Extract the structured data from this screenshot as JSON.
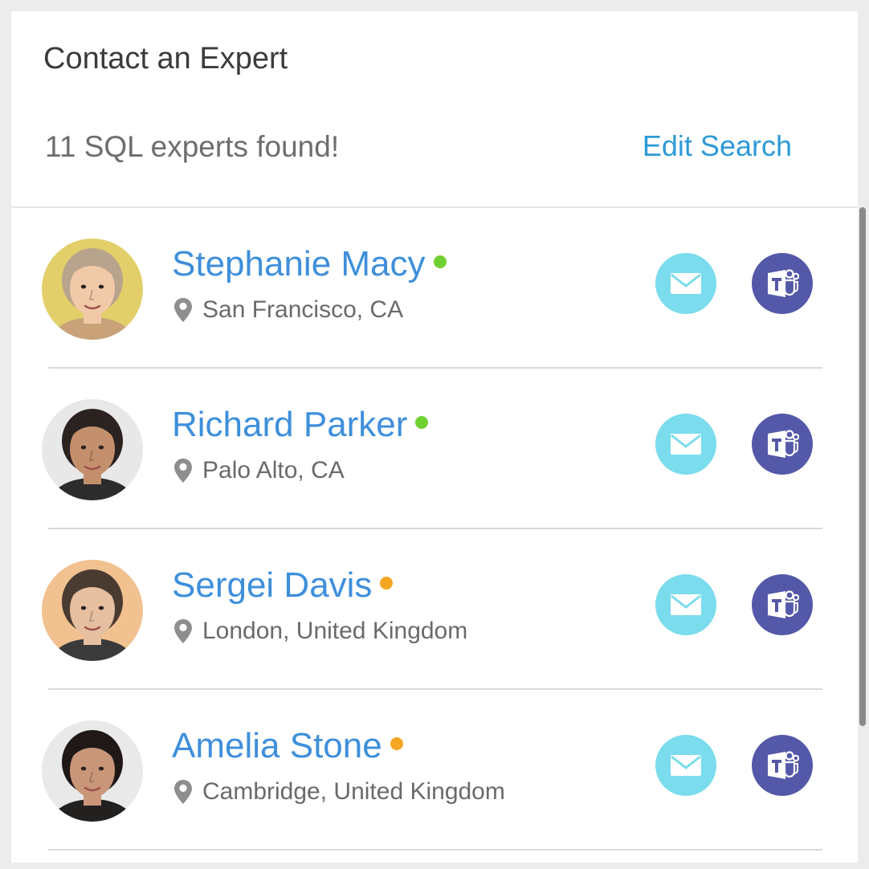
{
  "panel": {
    "title": "Contact an Expert",
    "result_count": "11 SQL experts found!",
    "edit_search_label": "Edit Search"
  },
  "colors": {
    "online": "#6fd131",
    "away": "#f5a623",
    "mail_button": "#7adcec",
    "teams_button": "#5458a8",
    "link": "#3e8fdb"
  },
  "experts": [
    {
      "name": "Stephanie Macy",
      "location": "San Francisco, CA",
      "status": "online",
      "avatar_bg": "#e2cf6a",
      "skin": "#f0c9a8",
      "hair": "#b8a48c",
      "clothing": "#c9a27a"
    },
    {
      "name": "Richard Parker",
      "location": "Palo Alto, CA",
      "status": "online",
      "avatar_bg": "#e8e8e8",
      "skin": "#c48f6c",
      "hair": "#2a2320",
      "clothing": "#2c2c2c"
    },
    {
      "name": "Sergei Davis",
      "location": "London, United Kingdom",
      "status": "away",
      "avatar_bg": "#f1c18f",
      "skin": "#e6bfa1",
      "hair": "#4a3b31",
      "clothing": "#3b3a3a"
    },
    {
      "name": "Amelia Stone",
      "location": "Cambridge, United Kingdom",
      "status": "away",
      "avatar_bg": "#e9e9e9",
      "skin": "#c9967a",
      "hair": "#1f1816",
      "clothing": "#232020"
    }
  ],
  "icons": {
    "mail": "mail-icon",
    "teams": "teams-icon",
    "location": "location-pin-icon"
  }
}
